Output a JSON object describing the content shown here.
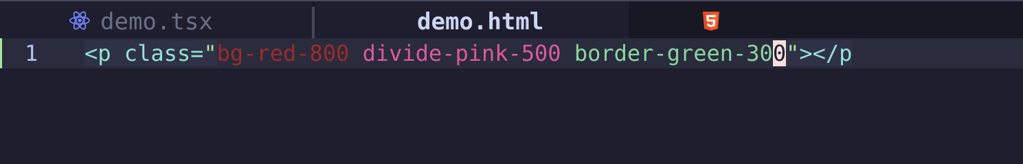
{
  "tabs": [
    {
      "label": "demo.tsx",
      "icon": "react-icon",
      "active": false
    },
    {
      "label": "demo.html",
      "icon": "html5-icon",
      "active": true
    }
  ],
  "editor": {
    "line_number": "1",
    "tokens": {
      "open": "<p",
      "space1": " ",
      "attr": "class",
      "eq": "=",
      "quote_open": "\"",
      "class1": "bg-red-800",
      "space2": " ",
      "class2": "divide-pink-500",
      "space3": " ",
      "class3_pre": "border-green-30",
      "cursor_char": "0",
      "quote_close": "\"",
      "close": "></p"
    }
  },
  "colors": {
    "background": "#1e1e2e",
    "react": "#7287fd",
    "html5": "#e44d26",
    "git_added": "#a6e3a1"
  }
}
